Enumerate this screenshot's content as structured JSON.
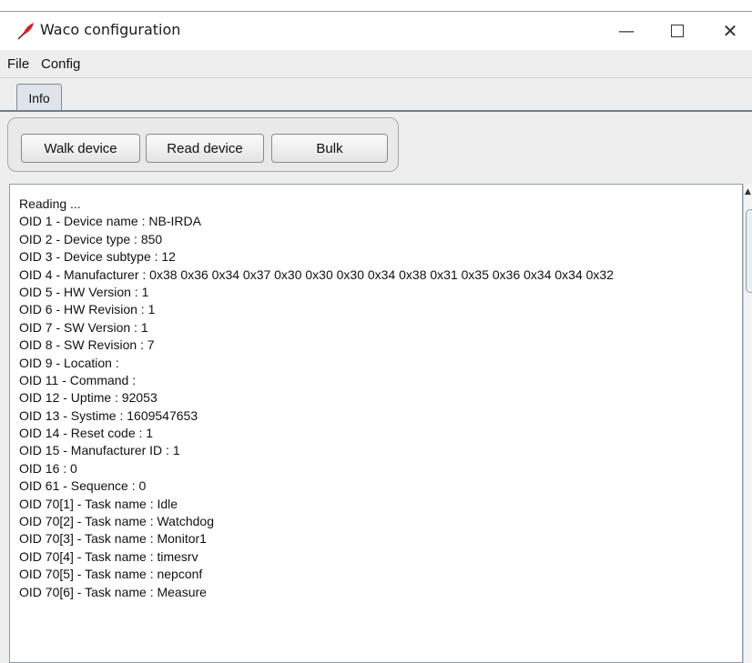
{
  "window": {
    "title": "Waco configuration",
    "minimize_glyph": "—",
    "close_glyph": "✕"
  },
  "menu": {
    "file": "File",
    "config": "Config"
  },
  "tabs": {
    "info": "Info"
  },
  "buttons": {
    "walk": "Walk device",
    "read": "Read device",
    "bulk": "Bulk"
  },
  "log": {
    "lines": [
      "Reading ...",
      "OID 1 - Device name : NB-IRDA",
      "OID 2 - Device type : 850",
      "OID 3 - Device subtype : 12",
      "OID 4 - Manufacturer : 0x38 0x36 0x34 0x37 0x30 0x30 0x30 0x34 0x38 0x31 0x35 0x36 0x34 0x34 0x32",
      "OID 5 - HW Version : 1",
      "OID 6 - HW Revision : 1",
      "OID 7 - SW Version : 1",
      "OID 8 - SW Revision : 7",
      "OID 9 - Location :",
      "OID 11 - Command :",
      "OID 12 - Uptime : 92053",
      "OID 13 - Systime : 1609547653",
      "OID 14 - Reset code : 1",
      "OID 15 - Manufacturer ID : 1",
      "OID 16 : 0",
      "OID 61 - Sequence : 0",
      "OID 70[1] - Task name : Idle",
      "OID 70[2] - Task name : Watchdog",
      "OID 70[3] - Task name : Monitor1",
      "OID 70[4] - Task name : timesrv",
      "OID 70[5] - Task name : nepconf",
      "OID 70[6] - Task name : Measure"
    ]
  },
  "icons": {
    "app": "red-feather-icon",
    "scroll_up": "scroll-up-arrow-icon"
  },
  "colors": {
    "app_icon_red": "#d2232a",
    "tab_border": "#6d7f8f"
  }
}
